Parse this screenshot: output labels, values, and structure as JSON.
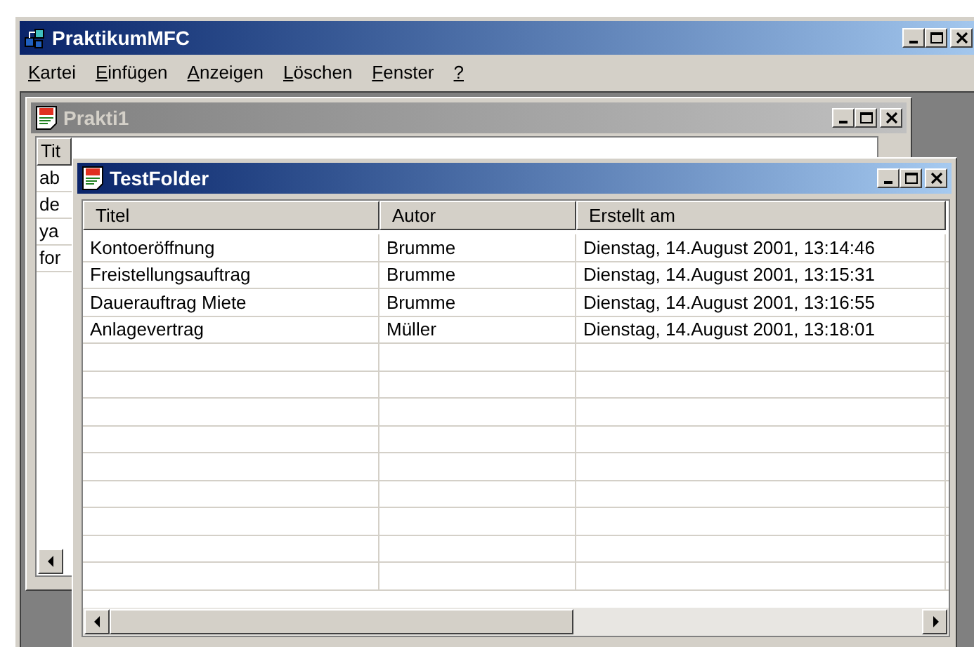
{
  "window": {
    "title": "PraktikumMFC"
  },
  "menu": [
    {
      "label": "Kartei",
      "underline_first": true
    },
    {
      "label": "Einfügen",
      "underline_first": true
    },
    {
      "label": "Anzeigen",
      "underline_first": true
    },
    {
      "label": "Löschen",
      "underline_first": true
    },
    {
      "label": "Fenster",
      "underline_first": true
    },
    {
      "label": "?",
      "underline_first": true
    }
  ],
  "back_window": {
    "title": "Prakti1",
    "active": false,
    "columns": [
      "Tit"
    ],
    "rows": [
      "ab",
      "de",
      "ya",
      "for"
    ]
  },
  "front_window": {
    "title": "TestFolder",
    "active": true,
    "columns": [
      "Titel",
      "Autor",
      "Erstellt am"
    ],
    "rows": [
      [
        "Kontoeröffnung",
        "Brumme",
        "Dienstag, 14.August 2001, 13:14:46"
      ],
      [
        "Freistellungsauftrag",
        "Brumme",
        "Dienstag, 14.August 2001, 13:15:31"
      ],
      [
        "Dauerauftrag Miete",
        "Brumme",
        "Dienstag, 14.August 2001, 13:16:55"
      ],
      [
        "Anlagevertrag",
        "Müller",
        "Dienstag, 14.August 2001, 13:18:01"
      ]
    ]
  }
}
